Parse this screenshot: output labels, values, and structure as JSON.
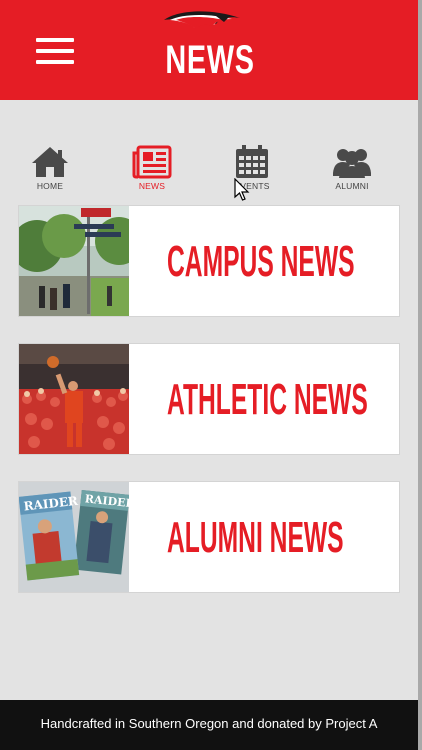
{
  "header": {
    "title": "NEWS",
    "menu_icon": "hamburger-menu-icon",
    "logo": "raider-logo"
  },
  "nav": {
    "items": [
      {
        "label": "HOME",
        "icon": "home-icon"
      },
      {
        "label": "NEWS",
        "icon": "newspaper-icon",
        "active": true
      },
      {
        "label": "EVENTS",
        "icon": "calendar-icon"
      },
      {
        "label": "ALUMNI",
        "icon": "group-icon"
      }
    ]
  },
  "cards": [
    {
      "title": "CAMPUS NEWS",
      "image": "campus-walkway-photo"
    },
    {
      "title": "ATHLETIC NEWS",
      "image": "basketball-crowd-photo"
    },
    {
      "title": "ALUMNI NEWS",
      "image": "raider-magazine-photo",
      "magazine_text": "RAIDER"
    }
  ],
  "footer": {
    "text": "Handcrafted in Southern Oregon and donated by Project A"
  },
  "colors": {
    "brand_red": "#e51d25",
    "background": "#e3e3e3",
    "footer_bg": "#111111"
  }
}
